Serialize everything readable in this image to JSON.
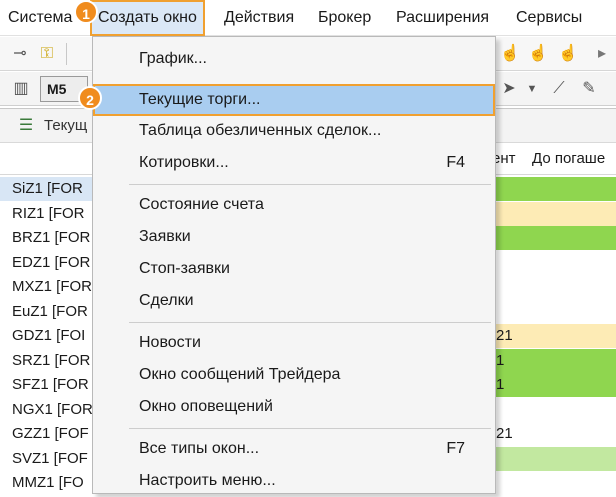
{
  "menubar": {
    "items": [
      {
        "label": "Система",
        "u": ""
      },
      {
        "label": "Создать окно",
        "u": ""
      },
      {
        "label": "Действия",
        "u": ""
      },
      {
        "label": "Брокер",
        "u": ""
      },
      {
        "label": "Расширения",
        "u": ""
      },
      {
        "label": "Сервисы",
        "u": ""
      }
    ]
  },
  "toolbar": {
    "timeframe": "M5"
  },
  "window": {
    "title": "Текущ",
    "columns": {
      "col1": "ент",
      "col2": "До погаше"
    },
    "rows": [
      {
        "symbol": "SiZ1 [FOR",
        "val": ""
      },
      {
        "symbol": "RIZ1 [FOR",
        "val": ""
      },
      {
        "symbol": "BRZ1 [FOR",
        "val": ""
      },
      {
        "symbol": "EDZ1 [FOR",
        "val": ""
      },
      {
        "symbol": "MXZ1 [FOR",
        "val": ""
      },
      {
        "symbol": "EuZ1 [FOR",
        "val": ""
      },
      {
        "symbol": "GDZ1 [FOI",
        "val": "21"
      },
      {
        "symbol": "SRZ1 [FOR",
        "val": "1"
      },
      {
        "symbol": "SFZ1 [FOR",
        "val": "1"
      },
      {
        "symbol": "NGX1 [FOR",
        "val": ""
      },
      {
        "symbol": "GZZ1 [FOF",
        "val": "21"
      },
      {
        "symbol": "SVZ1 [FOF",
        "val": ""
      },
      {
        "symbol": "MMZ1 [FO",
        "val": ""
      }
    ]
  },
  "popup": {
    "items": [
      {
        "label": "График...",
        "key": ""
      },
      {
        "label": "Текущие торги...",
        "key": ""
      },
      {
        "label": "Таблица обезличенных сделок...",
        "key": ""
      },
      {
        "label": "Котировки...",
        "key": "F4"
      },
      {
        "label": "Состояние счета",
        "key": ""
      },
      {
        "label": "Заявки",
        "key": ""
      },
      {
        "label": "Стоп-заявки",
        "key": ""
      },
      {
        "label": "Сделки",
        "key": ""
      },
      {
        "label": "Новости",
        "key": ""
      },
      {
        "label": "Окно сообщений Трейдера",
        "key": ""
      },
      {
        "label": "Окно оповещений",
        "key": ""
      },
      {
        "label": "Все типы окон...",
        "key": "F7"
      },
      {
        "label": "Настроить меню...",
        "key": ""
      }
    ]
  },
  "badges": {
    "one": "1",
    "two": "2"
  },
  "colors": {
    "green": "#8fd64f",
    "light_green": "#c2e8a0",
    "yellow": "#fdebb5",
    "highlight_border": "#f0a030",
    "menu_highlight": "#a9cdf0"
  }
}
